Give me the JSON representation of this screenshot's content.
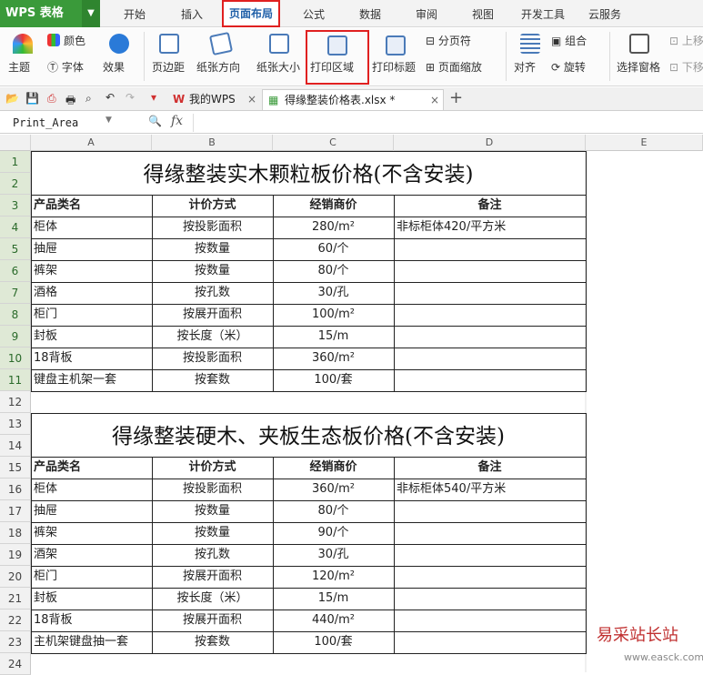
{
  "app": {
    "logo": "WPS 表格"
  },
  "tabs": [
    "开始",
    "插入",
    "页面布局",
    "公式",
    "数据",
    "审阅",
    "视图",
    "开发工具",
    "云服务"
  ],
  "ribbon": {
    "theme": "主题",
    "color": "颜色",
    "font": "字体",
    "effect": "效果",
    "margin": "页边距",
    "orientation": "纸张方向",
    "size": "纸张大小",
    "print_area": "打印区域",
    "print_title": "打印标题",
    "page_break": "分页符",
    "page_zoom": "页面缩放",
    "align": "对齐",
    "group": "组合",
    "rotate": "旋转",
    "select_pane": "选择窗格",
    "up": "上移",
    "down": "下移"
  },
  "filebar": {
    "my_wps": "我的WPS",
    "doc": "得缘整装价格表.xlsx *",
    "plus": "+"
  },
  "formula": {
    "name_box": "Print_Area",
    "fx": "fx"
  },
  "columns": [
    "A",
    "B",
    "C",
    "D",
    "E"
  ],
  "rows": [
    "1",
    "2",
    "3",
    "4",
    "5",
    "6",
    "7",
    "8",
    "9",
    "10",
    "11",
    "12",
    "13",
    "14",
    "15",
    "16",
    "17",
    "18",
    "19",
    "20",
    "21",
    "22",
    "23",
    "24"
  ],
  "table1": {
    "title": "得缘整装实木颗粒板价格(不含安装)",
    "headers": [
      "产品类名",
      "计价方式",
      "经销商价",
      "备注"
    ],
    "rows": [
      [
        "柜体",
        "按投影面积",
        "280/m²",
        "非标柜体420/平方米"
      ],
      [
        "抽屉",
        "按数量",
        "60/个",
        ""
      ],
      [
        "裤架",
        "按数量",
        "80/个",
        ""
      ],
      [
        "酒格",
        "按孔数",
        "30/孔",
        ""
      ],
      [
        "柜门",
        "按展开面积",
        "100/m²",
        ""
      ],
      [
        "封板",
        "按长度（米）",
        "15/m",
        ""
      ],
      [
        "18背板",
        "按投影面积",
        "360/m²",
        ""
      ],
      [
        "键盘主机架一套",
        "按套数",
        "100/套",
        ""
      ]
    ]
  },
  "table2": {
    "title": "得缘整装硬木、夹板生态板价格(不含安装)",
    "headers": [
      "产品类名",
      "计价方式",
      "经销商价",
      "备注"
    ],
    "rows": [
      [
        "柜体",
        "按投影面积",
        "360/m²",
        "非标柜体540/平方米"
      ],
      [
        "抽屉",
        "按数量",
        "80/个",
        ""
      ],
      [
        "裤架",
        "按数量",
        "90/个",
        ""
      ],
      [
        "酒架",
        "按孔数",
        "30/孔",
        ""
      ],
      [
        "柜门",
        "按展开面积",
        "120/m²",
        ""
      ],
      [
        "封板",
        "按长度（米）",
        "15/m",
        ""
      ],
      [
        "18背板",
        "按展开面积",
        "440/m²",
        ""
      ],
      [
        "主机架键盘抽一套",
        "按套数",
        "100/套",
        ""
      ]
    ]
  },
  "watermark": {
    "name": "易采站长站",
    "url": "www.easck.com"
  }
}
